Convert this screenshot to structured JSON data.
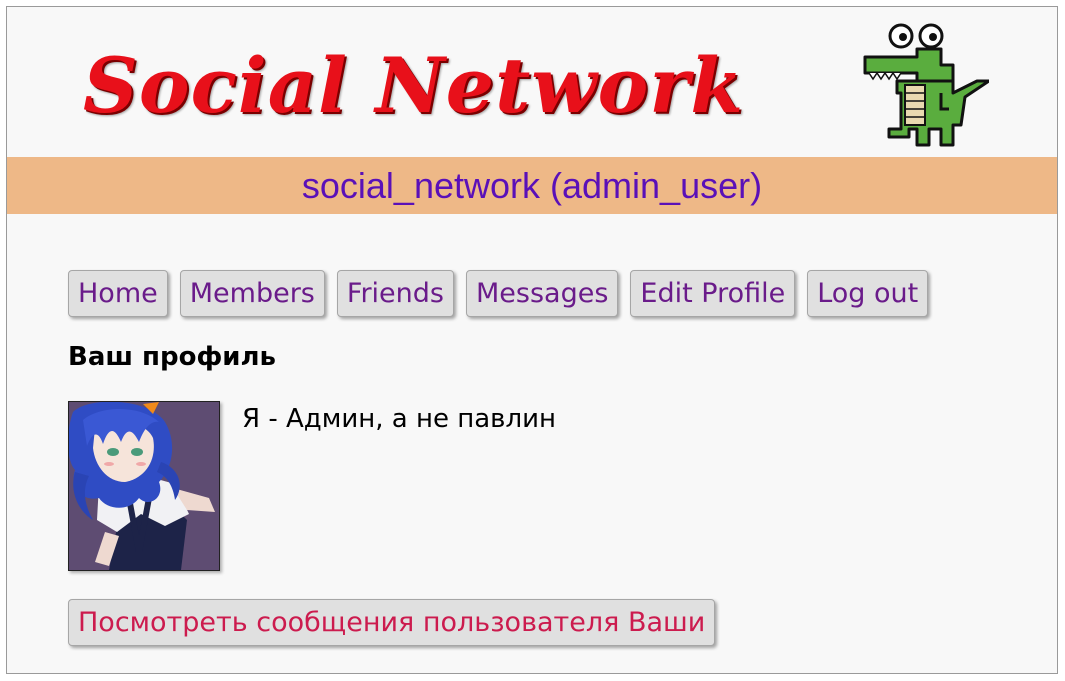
{
  "header": {
    "logo_text": "Social Network",
    "logo_icon": "crocodile-icon",
    "banner_text": "social_network (admin_user)",
    "colors": {
      "logo_red": "#e8101a",
      "banner_bg": "#eeb887",
      "banner_text": "#5a10b8"
    }
  },
  "nav": {
    "items": [
      {
        "label": "Home"
      },
      {
        "label": "Members"
      },
      {
        "label": "Friends"
      },
      {
        "label": "Messages"
      },
      {
        "label": "Edit Profile"
      },
      {
        "label": "Log out"
      }
    ],
    "link_color": "#6a1b8a"
  },
  "profile": {
    "title": "Ваш профиль",
    "avatar_icon": "anime-avatar-image",
    "about_text": "Я - Админ, а не павлин",
    "view_messages_label": "Посмотреть сообщения пользователя Ваши",
    "view_messages_color": "#cc1b4e"
  }
}
